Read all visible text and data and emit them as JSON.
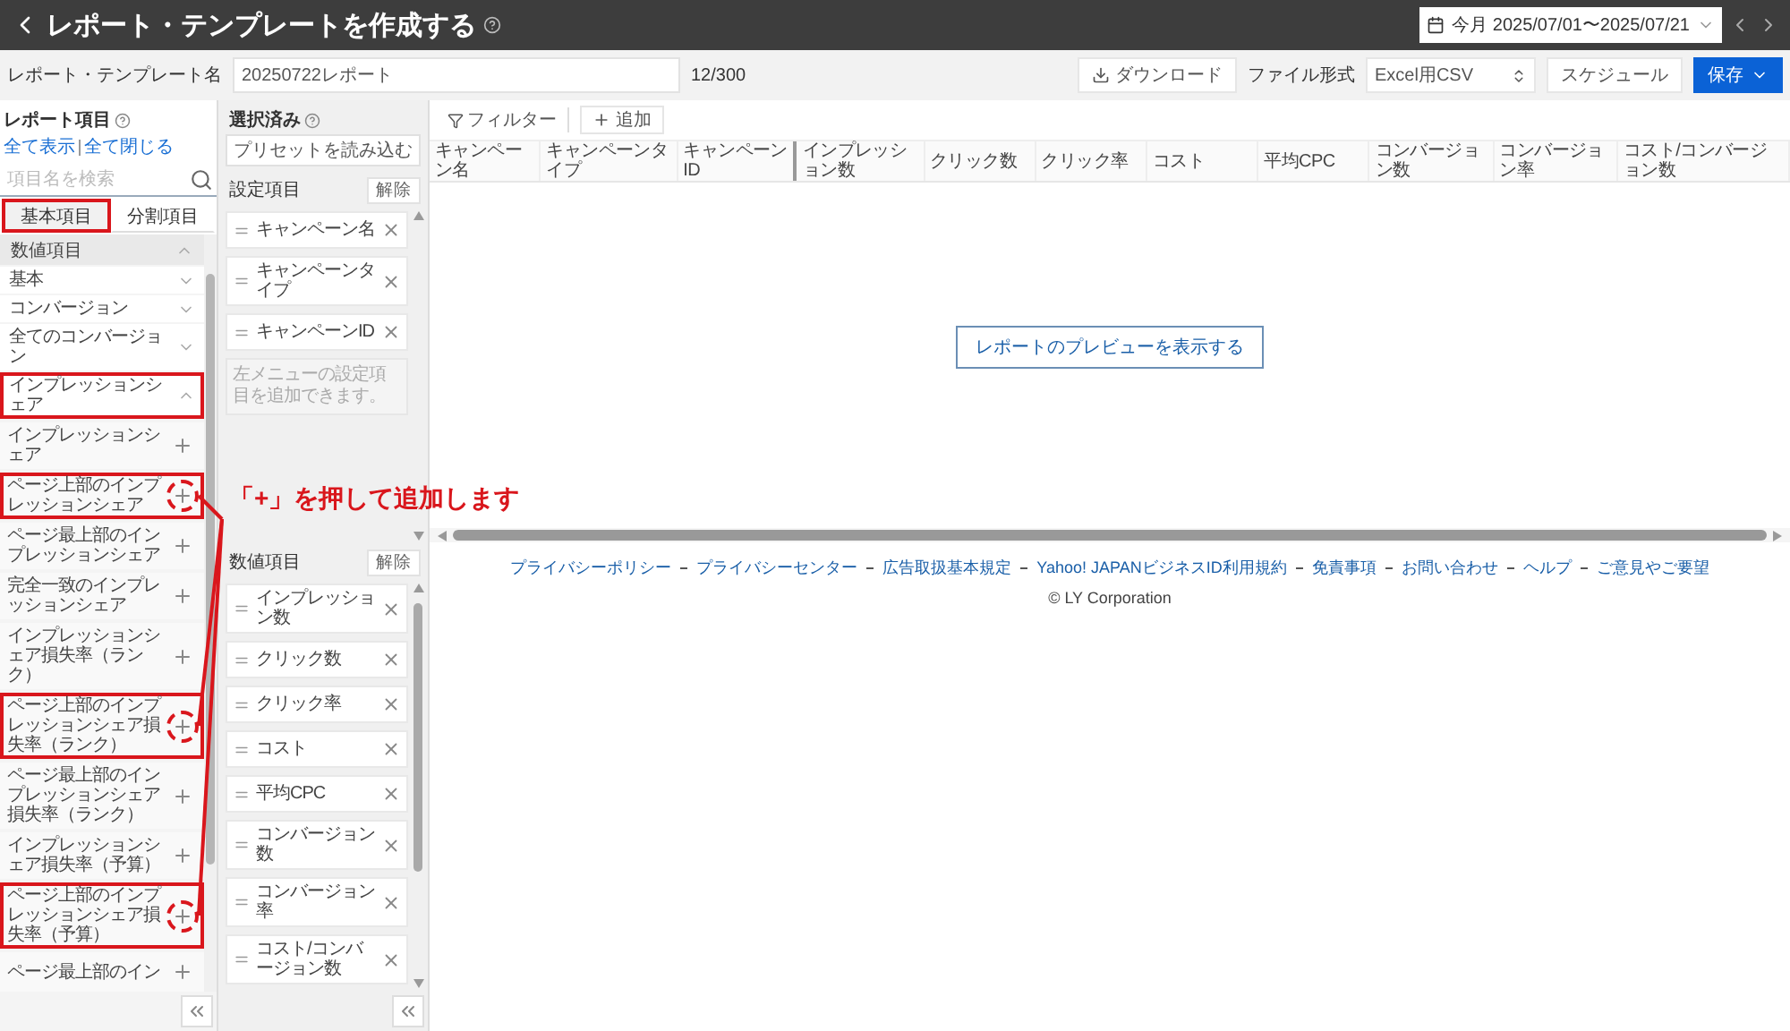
{
  "header": {
    "title": "レポート・テンプレートを作成する",
    "date_range": "今月 2025/07/01〜2025/07/21"
  },
  "name_row": {
    "label": "レポート・テンプレート名",
    "value": "20250722レポート",
    "counter": "12/300",
    "download": "ダウンロード",
    "format_label": "ファイル形式",
    "format_value": "Excel用CSV",
    "schedule": "スケジュール",
    "save": "保存"
  },
  "report_items": {
    "title": "レポート項目",
    "links": [
      "全て表示",
      "全て閉じる"
    ],
    "search_placeholder": "項目名を検索",
    "tabs": [
      {
        "label": "基本項目",
        "selected": true,
        "highlighted": true
      },
      {
        "label": "分割項目",
        "selected": false,
        "highlighted": false
      }
    ],
    "section": {
      "label": "数値項目",
      "expanded": true
    },
    "groups": [
      {
        "label": "基本",
        "expanded": false,
        "highlighted": false
      },
      {
        "label": "コンバージョン",
        "expanded": false,
        "highlighted": false
      },
      {
        "label": "全てのコンバージョン",
        "expanded": false,
        "highlighted": false
      },
      {
        "label": "インプレッションシェア",
        "expanded": true,
        "highlighted": true,
        "children": [
          {
            "label": "インプレッションシェア",
            "highlighted": false,
            "circled": false
          },
          {
            "label": "ページ上部のインプレッションシェア",
            "highlighted": true,
            "circled": true
          },
          {
            "label": "ページ最上部のインプレッションシェア",
            "highlighted": false,
            "circled": false
          },
          {
            "label": "完全一致のインプレッションシェア",
            "highlighted": false,
            "circled": false
          },
          {
            "label": "インプレッションシェア損失率（ランク）",
            "highlighted": false,
            "circled": false
          },
          {
            "label": "ページ上部のインプレッションシェア損失率（ランク）",
            "highlighted": true,
            "circled": true
          },
          {
            "label": "ページ最上部のインプレッションシェア損失率（ランク）",
            "highlighted": false,
            "circled": false
          },
          {
            "label": "インプレッションシェア損失率（予算）",
            "highlighted": false,
            "circled": false
          },
          {
            "label": "ページ上部のインプレッションシェア損失率（予算）",
            "highlighted": true,
            "circled": true
          },
          {
            "label": "ページ最上部のイン",
            "highlighted": false,
            "circled": false
          }
        ]
      }
    ]
  },
  "selected": {
    "title": "選択済み",
    "preset": "プリセットを読み込む",
    "sections": [
      {
        "title": "設定項目",
        "clear": "解除",
        "items": [
          "キャンペーン名",
          "キャンペーンタイプ",
          "キャンペーンID"
        ],
        "hint": "左メニューの設定項目を追加できます。"
      },
      {
        "title": "数値項目",
        "clear": "解除",
        "items": [
          "インプレッション数",
          "クリック数",
          "クリック率",
          "コスト",
          "平均CPC",
          "コンバージョン数",
          "コンバージョン率",
          "コスト/コンバージョン数"
        ]
      }
    ]
  },
  "main": {
    "filter": "フィルター",
    "add": "追加",
    "columns": [
      "キャンペーン名",
      "キャンペーンタイプ",
      "キャンペーンID",
      "インプレッション数",
      "クリック数",
      "クリック率",
      "コスト",
      "平均CPC",
      "コンバージョン数",
      "コンバージョン率",
      "コスト/コンバージョン数"
    ],
    "preview": "レポートのプレビューを表示する"
  },
  "footer": {
    "links": [
      "プライバシーポリシー",
      "プライバシーセンター",
      "広告取扱基本規定",
      "Yahoo! JAPANビジネスID利用規約",
      "免責事項",
      "お問い合わせ",
      "ヘルプ",
      "ご意見やご要望"
    ],
    "copyright": "© LY Corporation"
  },
  "annotation": {
    "text": "「+」を押して追加します"
  }
}
